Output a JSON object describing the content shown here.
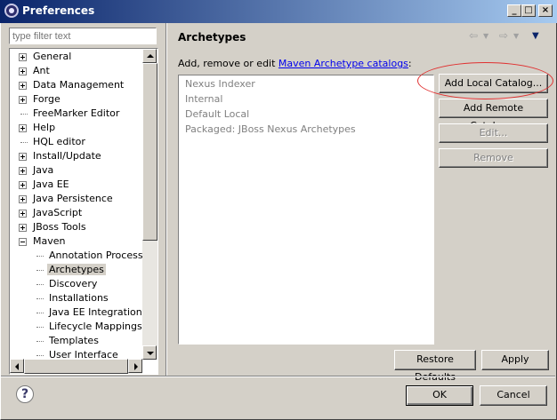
{
  "window": {
    "title": "Preferences",
    "minimize": "_",
    "maximize": "□",
    "close": "×"
  },
  "filter": {
    "placeholder": "type filter text"
  },
  "tree": {
    "items": [
      {
        "label": "General",
        "level": 0,
        "expander": "plus"
      },
      {
        "label": "Ant",
        "level": 0,
        "expander": "plus"
      },
      {
        "label": "Data Management",
        "level": 0,
        "expander": "plus"
      },
      {
        "label": "Forge",
        "level": 0,
        "expander": "plus"
      },
      {
        "label": "FreeMarker Editor",
        "level": 0,
        "expander": "none"
      },
      {
        "label": "Help",
        "level": 0,
        "expander": "plus"
      },
      {
        "label": "HQL editor",
        "level": 0,
        "expander": "none"
      },
      {
        "label": "Install/Update",
        "level": 0,
        "expander": "plus"
      },
      {
        "label": "Java",
        "level": 0,
        "expander": "plus"
      },
      {
        "label": "Java EE",
        "level": 0,
        "expander": "plus"
      },
      {
        "label": "Java Persistence",
        "level": 0,
        "expander": "plus"
      },
      {
        "label": "JavaScript",
        "level": 0,
        "expander": "plus"
      },
      {
        "label": "JBoss Tools",
        "level": 0,
        "expander": "plus"
      },
      {
        "label": "Maven",
        "level": 0,
        "expander": "minus"
      },
      {
        "label": "Annotation Processing",
        "level": 1,
        "expander": "none"
      },
      {
        "label": "Archetypes",
        "level": 1,
        "expander": "none",
        "selected": true
      },
      {
        "label": "Discovery",
        "level": 1,
        "expander": "none"
      },
      {
        "label": "Installations",
        "level": 1,
        "expander": "none"
      },
      {
        "label": "Java EE Integration",
        "level": 1,
        "expander": "none"
      },
      {
        "label": "Lifecycle Mappings",
        "level": 1,
        "expander": "none"
      },
      {
        "label": "Templates",
        "level": 1,
        "expander": "none"
      },
      {
        "label": "User Interface",
        "level": 1,
        "expander": "none"
      }
    ]
  },
  "page": {
    "title": "Archetypes",
    "desc_prefix": "Add, remove or edit ",
    "desc_link": "Maven Archetype catalogs",
    "desc_suffix": ":"
  },
  "catalogs": [
    "Nexus Indexer",
    "Internal",
    "Default Local",
    "Packaged: JBoss Nexus Archetypes"
  ],
  "buttons": {
    "add_local": "Add Local Catalog...",
    "add_remote": "Add Remote Catalog...",
    "edit": "Edit...",
    "remove": "Remove",
    "restore_defaults": "Restore Defaults",
    "apply": "Apply",
    "ok": "OK",
    "cancel": "Cancel"
  },
  "colors": {
    "titlebar_start": "#0a246a",
    "link": "#0000ee",
    "highlight": "#e03030"
  }
}
